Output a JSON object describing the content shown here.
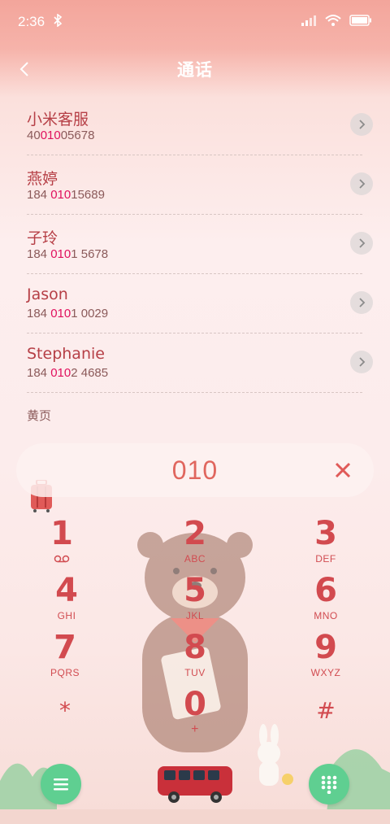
{
  "status_bar": {
    "time": "2:36"
  },
  "header": {
    "title": "通话"
  },
  "results": [
    {
      "name": "小米客服",
      "number_pre": "40",
      "number_hl": "010",
      "number_post": "05678"
    },
    {
      "name": "燕婷",
      "number_pre": "184 ",
      "number_hl": "010",
      "number_post": "15689"
    },
    {
      "name": "子玲",
      "number_pre": "184 ",
      "number_hl": "010",
      "number_post": "1 5678"
    },
    {
      "name": "Jason",
      "number_pre": "184 ",
      "number_hl": "010",
      "number_post": "1 0029"
    },
    {
      "name": "Stephanie",
      "number_pre": "184 ",
      "number_hl": "010",
      "number_post": "2 4685"
    }
  ],
  "yellow_pages_label": "黄页",
  "dial_input": {
    "value": "010"
  },
  "keypad": {
    "keys": [
      {
        "digit": "1",
        "letters": ""
      },
      {
        "digit": "2",
        "letters": "ABC"
      },
      {
        "digit": "3",
        "letters": "DEF"
      },
      {
        "digit": "4",
        "letters": "GHI"
      },
      {
        "digit": "5",
        "letters": "JKL"
      },
      {
        "digit": "6",
        "letters": "MNO"
      },
      {
        "digit": "7",
        "letters": "PQRS"
      },
      {
        "digit": "8",
        "letters": "TUV"
      },
      {
        "digit": "9",
        "letters": "WXYZ"
      },
      {
        "digit": "*",
        "letters": ""
      },
      {
        "digit": "0",
        "letters": "+"
      },
      {
        "digit": "#",
        "letters": ""
      }
    ]
  },
  "colors": {
    "accent": "#d24a4f",
    "highlight": "#e0115e",
    "fab": "#5fcf91",
    "header_bg": "#f3a59b"
  },
  "icons": [
    "bluetooth-icon",
    "signal-icon",
    "wifi-icon",
    "battery-icon",
    "back-icon",
    "chevron-right-icon",
    "clear-icon",
    "voicemail-icon",
    "menu-icon",
    "dialpad-icon"
  ]
}
